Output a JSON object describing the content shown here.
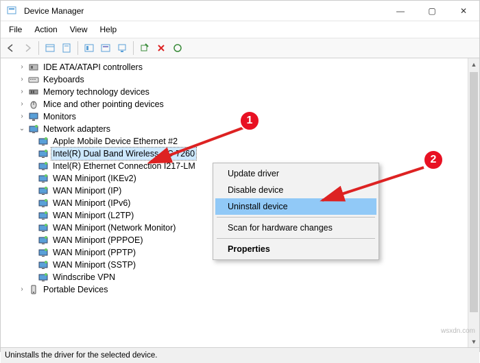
{
  "window": {
    "title": "Device Manager",
    "min": "—",
    "max": "▢",
    "close": "✕"
  },
  "menubar": [
    "File",
    "Action",
    "View",
    "Help"
  ],
  "tree": {
    "categories": [
      {
        "label": "IDE ATA/ATAPI controllers",
        "expanded": false,
        "indent": 1,
        "icon": "ide"
      },
      {
        "label": "Keyboards",
        "expanded": false,
        "indent": 1,
        "icon": "keyboard"
      },
      {
        "label": "Memory technology devices",
        "expanded": false,
        "indent": 1,
        "icon": "memory"
      },
      {
        "label": "Mice and other pointing devices",
        "expanded": false,
        "indent": 1,
        "icon": "mouse"
      },
      {
        "label": "Monitors",
        "expanded": false,
        "indent": 1,
        "icon": "monitor"
      },
      {
        "label": "Network adapters",
        "expanded": true,
        "indent": 1,
        "icon": "net",
        "children": [
          {
            "label": "Apple Mobile Device Ethernet #2"
          },
          {
            "label": "Intel(R) Dual Band Wireless-AC 7260",
            "selected": true
          },
          {
            "label": "Intel(R) Ethernet Connection I217-LM"
          },
          {
            "label": "WAN Miniport (IKEv2)"
          },
          {
            "label": "WAN Miniport (IP)"
          },
          {
            "label": "WAN Miniport (IPv6)"
          },
          {
            "label": "WAN Miniport (L2TP)"
          },
          {
            "label": "WAN Miniport (Network Monitor)"
          },
          {
            "label": "WAN Miniport (PPPOE)"
          },
          {
            "label": "WAN Miniport (PPTP)"
          },
          {
            "label": "WAN Miniport (SSTP)"
          },
          {
            "label": "Windscribe VPN"
          }
        ]
      },
      {
        "label": "Portable Devices",
        "expanded": false,
        "indent": 1,
        "icon": "portable"
      }
    ]
  },
  "context_menu": {
    "items": [
      {
        "label": "Update driver"
      },
      {
        "label": "Disable device"
      },
      {
        "label": "Uninstall device",
        "highlight": true
      },
      {
        "sep": true
      },
      {
        "label": "Scan for hardware changes"
      },
      {
        "sep": true
      },
      {
        "label": "Properties",
        "bold": true
      }
    ]
  },
  "status": "Uninstalls the driver for the selected device.",
  "callouts": {
    "1": "1",
    "2": "2"
  },
  "watermark": "wsxdn.com"
}
